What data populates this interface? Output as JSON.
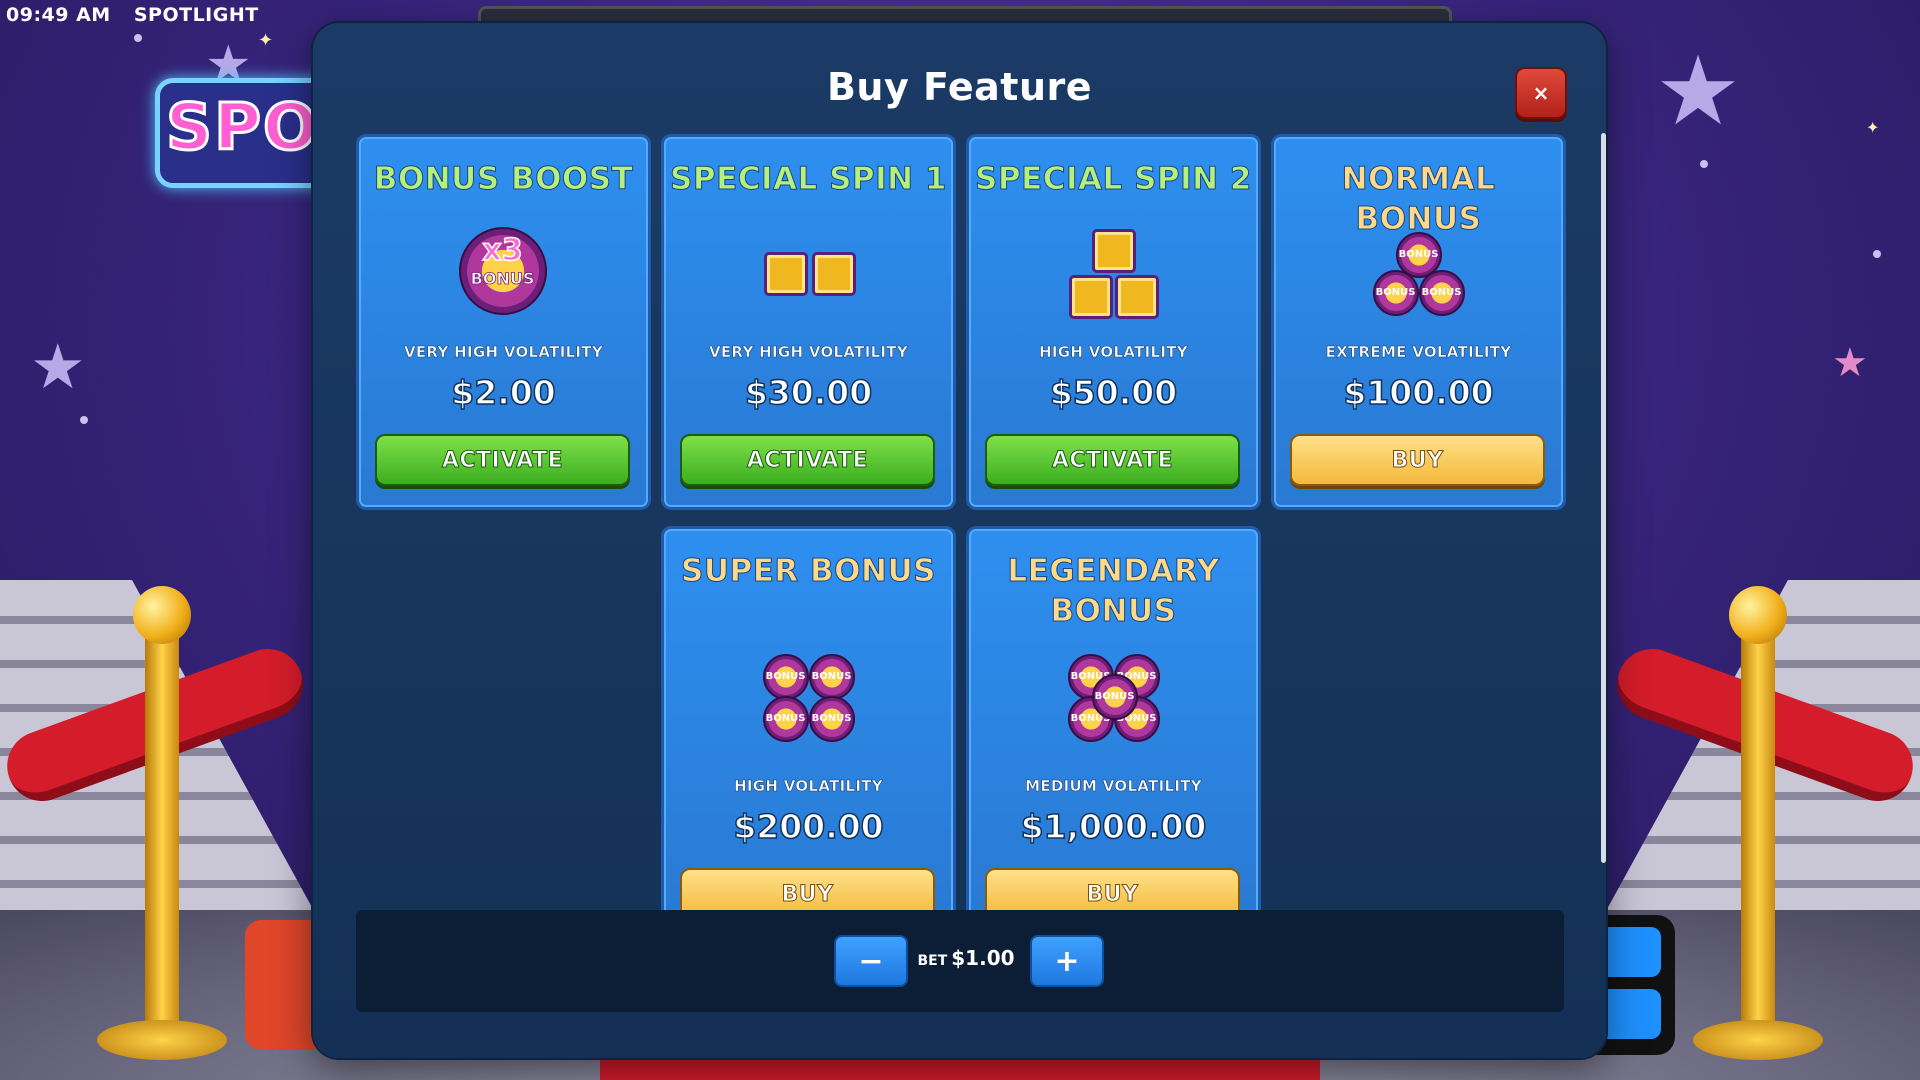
{
  "status_bar": {
    "time": "09:49 AM",
    "game_name": "SPOTLIGHT"
  },
  "background": {
    "logo_text": "SPOTL"
  },
  "modal": {
    "title": "Buy Feature",
    "close_label": "×"
  },
  "cards": [
    {
      "title": "BONUS BOOST",
      "icon": "x3-bonus-chip-icon",
      "icon_text": "x3",
      "icon_sub": "BONUS",
      "volatility": "VERY HIGH VOLATILITY",
      "price": "$2.00",
      "button": "ACTIVATE"
    },
    {
      "title": "SPECIAL SPIN 1",
      "icon": "two-tickets-icon",
      "volatility": "VERY HIGH VOLATILITY",
      "price": "$30.00",
      "button": "ACTIVATE"
    },
    {
      "title": "SPECIAL SPIN 2",
      "icon": "three-tickets-icon",
      "volatility": "HIGH VOLATILITY",
      "price": "$50.00",
      "button": "ACTIVATE"
    },
    {
      "title": "NORMAL BONUS",
      "icon": "three-bonus-chips-icon",
      "chip_text": "BONUS",
      "volatility": "EXTREME VOLATILITY",
      "price": "$100.00",
      "button": "BUY"
    },
    {
      "title": "SUPER BONUS",
      "icon": "four-bonus-chips-icon",
      "chip_text": "BONUS",
      "volatility": "HIGH VOLATILITY",
      "price": "$200.00",
      "button": "BUY"
    },
    {
      "title_line1": "LEGENDARY",
      "title_line2": "BONUS",
      "icon": "five-bonus-chips-icon",
      "chip_text": "BONUS",
      "volatility": "MEDIUM VOLATILITY",
      "price": "$1,000.00",
      "button": "BUY"
    }
  ],
  "footer": {
    "minus_label": "−",
    "plus_label": "+",
    "bet_label": "BET",
    "bet_value": "$1.00"
  },
  "colors": {
    "modal_bg": "#1b3b66",
    "card_bg": "#2e8ff0",
    "activate_green": "#3cae1f",
    "buy_gold": "#f3b93a",
    "close_red": "#c62a1f",
    "title_green": "#b6ef7c",
    "title_gold": "#ffd98a"
  }
}
